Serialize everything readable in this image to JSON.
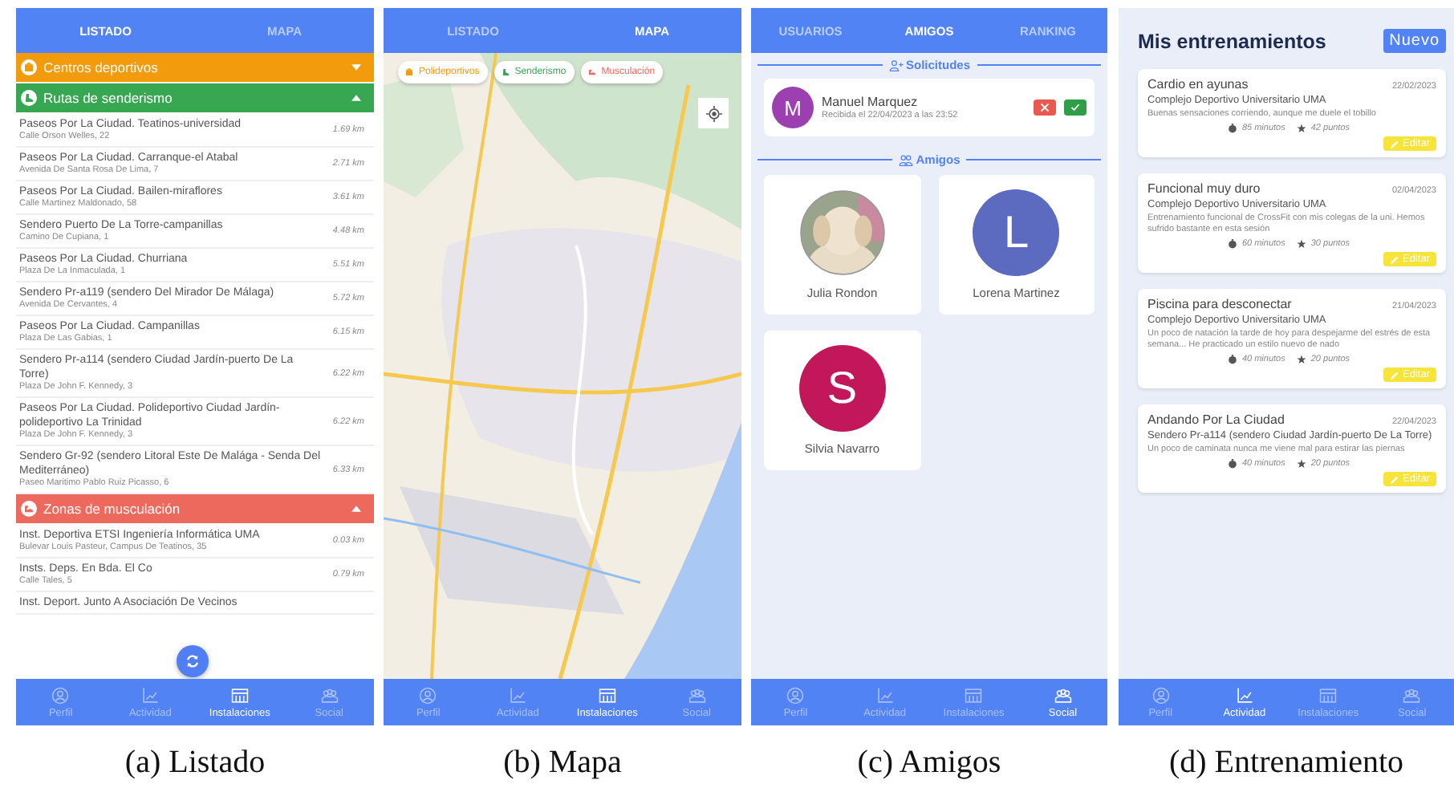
{
  "panels": [
    {
      "kind": "listado",
      "caption": "(a) Listado",
      "tabs": [
        {
          "label": "LISTADO",
          "selected": true
        },
        {
          "label": "MAPA",
          "selected": false
        }
      ],
      "sections": [
        {
          "kind": "polideportivos",
          "title": "Centros deportivos",
          "color": "#f29b0c",
          "expanded": false
        },
        {
          "kind": "senderismo",
          "title": "Rutas de senderismo",
          "color": "#38a752",
          "expanded": true,
          "items": [
            {
              "name": "Paseos Por La Ciudad. Teatinos-universidad",
              "address": "Calle Orson Welles, 22",
              "distance": "1.69 km"
            },
            {
              "name": "Paseos Por La Ciudad. Carranque-el Atabal",
              "address": "Avenida De Santa Rosa De Lima, 7",
              "distance": "2.71 km"
            },
            {
              "name": "Paseos Por La Ciudad. Bailen-miraflores",
              "address": "Calle Martinez Maldonado, 58",
              "distance": "3.61 km"
            },
            {
              "name": "Sendero Puerto De La Torre-campanillas",
              "address": "Camino De Cupiana, 1",
              "distance": "4.48 km"
            },
            {
              "name": "Paseos Por La Ciudad. Churriana",
              "address": "Plaza De La Inmaculada, 1",
              "distance": "5.51 km"
            },
            {
              "name": "Sendero Pr-a119 (sendero Del Mirador De Málaga)",
              "address": "Avenida De Cervantes, 4",
              "distance": "5.72 km"
            },
            {
              "name": "Paseos Por La Ciudad. Campanillas",
              "address": "Plaza De Las Gabias, 1",
              "distance": "6.15 km"
            },
            {
              "name": "Sendero Pr-a114 (sendero Ciudad Jardín-puerto De La Torre)",
              "address": "Plaza De John F. Kennedy, 3",
              "distance": "6.22 km"
            },
            {
              "name": "Paseos Por La Ciudad. Polideportivo Ciudad Jardín-polideportivo La Trinidad",
              "address": "Plaza De John F. Kennedy, 3",
              "distance": "6.22 km"
            },
            {
              "name": "Sendero Gr-92 (sendero Litoral Este De Malága - Senda Del Mediterráneo)",
              "address": "Paseo Maritimo Pablo Ruiz Picasso, 6",
              "distance": "6.33 km"
            }
          ]
        },
        {
          "kind": "musculacion",
          "title": "Zonas de musculación",
          "color": "#ee695d",
          "expanded": true,
          "items": [
            {
              "name": "Inst. Deportiva ETSI Ingeniería Informática UMA",
              "address": "Bulevar Louis Pasteur, Campus De Teatinos, 35",
              "distance": "0.03 km"
            },
            {
              "name": "Insts. Deps. En Bda. El Co",
              "address": "Calle Tales, 5",
              "distance": "0.79 km"
            },
            {
              "name": "Inst. Deport. Junto A Asociación De Vecinos"
            }
          ]
        }
      ],
      "nav": [
        {
          "kind": "perfil",
          "label": "Perfil",
          "selected": false
        },
        {
          "kind": "actividad",
          "label": "Actividad",
          "selected": false
        },
        {
          "kind": "instalaciones",
          "label": "Instalaciones",
          "selected": true
        },
        {
          "kind": "social",
          "label": "Social",
          "selected": false
        }
      ]
    },
    {
      "kind": "mapa",
      "caption": "(b) Mapa",
      "tabs": [
        {
          "label": "LISTADO",
          "selected": false
        },
        {
          "label": "MAPA",
          "selected": true
        }
      ],
      "filters": [
        {
          "kind": "polideportivos",
          "label": "Polideportivos",
          "color": "#f29b0c"
        },
        {
          "kind": "senderismo",
          "label": "Senderismo",
          "color": "#38a752"
        },
        {
          "kind": "musculacion",
          "label": "Musculación",
          "color": "#ee695d"
        }
      ],
      "nav": [
        {
          "kind": "perfil",
          "label": "Perfil",
          "selected": false
        },
        {
          "kind": "actividad",
          "label": "Actividad",
          "selected": false
        },
        {
          "kind": "instalaciones",
          "label": "Instalaciones",
          "selected": true
        },
        {
          "kind": "social",
          "label": "Social",
          "selected": false
        }
      ]
    },
    {
      "kind": "amigos",
      "caption": "(c) Amigos",
      "tabs": [
        {
          "label": "USUARIOS",
          "selected": false
        },
        {
          "label": "AMIGOS",
          "selected": true
        },
        {
          "label": "RANKING",
          "selected": false
        }
      ],
      "requests_title": "Solicitudes",
      "requests": [
        {
          "initial": "M",
          "color": "#9c3fb0",
          "name": "Manuel Marquez",
          "received": "Recibida el 22/04/2023 a las 23:52"
        }
      ],
      "friends_title": "Amigos",
      "friends": [
        {
          "name": "Julia Rondon"
        },
        {
          "kind": "initial",
          "initial": "L",
          "color": "#5c6bc0",
          "name": "Lorena Martinez"
        },
        {
          "kind": "initial",
          "initial": "S",
          "color": "#c2185b",
          "name": "Silvia Navarro"
        }
      ],
      "nav": [
        {
          "kind": "perfil",
          "label": "Perfil",
          "selected": false
        },
        {
          "kind": "actividad",
          "label": "Actividad",
          "selected": false
        },
        {
          "kind": "instalaciones",
          "label": "Instalaciones",
          "selected": false
        },
        {
          "kind": "social",
          "label": "Social",
          "selected": true
        }
      ]
    },
    {
      "kind": "entrenamientos",
      "caption": "(d) Entrenamiento",
      "title": "Mis entrenamientos",
      "new_button": "Nuevo",
      "trainings": [
        {
          "title": "Cardio en ayunas",
          "date": "22/02/2023",
          "place": "Complejo Deportivo Universitario UMA",
          "note": "Buenas sensaciones corriendo, aunque me duele el tobillo",
          "minutes": "85 minutos",
          "points": "42 puntos",
          "edit": "Editar"
        },
        {
          "title": "Funcional muy duro",
          "date": "02/04/2023",
          "place": "Complejo Deportivo Universitario UMA",
          "note": "Entrenamiento funcional de CrossFit con mis colegas de la uni. Hemos sufrido bastante en esta sesión",
          "minutes": "60 minutos",
          "points": "30 puntos",
          "edit": "Editar"
        },
        {
          "title": "Piscina para desconectar",
          "date": "21/04/2023",
          "place": "Complejo Deportivo Universitario UMA",
          "note": "Un poco de natación la tarde de hoy para despejarme del estrés de esta semana... He practicado un estilo nuevo de nado",
          "minutes": "40 minutos",
          "points": "20 puntos",
          "edit": "Editar"
        },
        {
          "title": "Andando Por La Ciudad",
          "date": "22/04/2023",
          "place": "Sendero Pr-a114 (sendero Ciudad Jardín-puerto De La Torre)",
          "note": "Un poco de caminata nunca me viene mal para estirar las piernas",
          "minutes": "40 minutos",
          "points": "20 puntos",
          "edit": "Editar"
        }
      ],
      "nav": [
        {
          "kind": "perfil",
          "label": "Perfil",
          "selected": false
        },
        {
          "kind": "actividad",
          "label": "Actividad",
          "selected": true
        },
        {
          "kind": "instalaciones",
          "label": "Instalaciones",
          "selected": false
        },
        {
          "kind": "social",
          "label": "Social",
          "selected": false
        }
      ]
    }
  ]
}
